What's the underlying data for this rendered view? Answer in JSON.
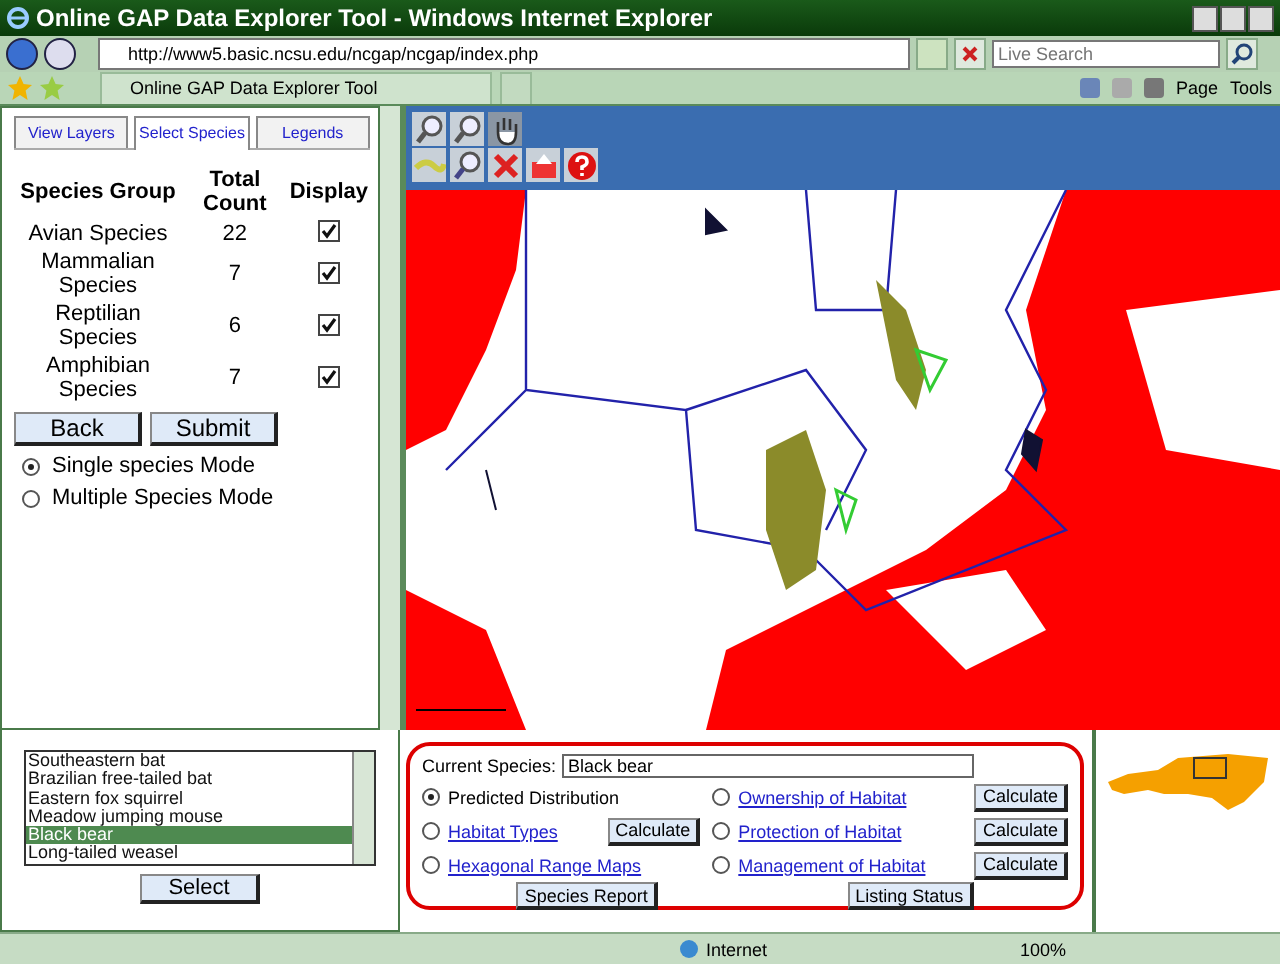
{
  "window": {
    "title": "Online GAP Data Explorer Tool - Windows Internet Explorer"
  },
  "browser": {
    "address": "http://www5.basic.ncsu.edu/ncgap/ncgap/index.php",
    "search": {
      "placeholder": "Live Search"
    },
    "tab_title": "Online GAP Data Explorer Tool",
    "commands": [
      {
        "label": "Page"
      },
      {
        "label": "Tools"
      }
    ]
  },
  "left_panel": {
    "tabs": [
      {
        "label": "View Layers",
        "selected": false
      },
      {
        "label": "Select Species",
        "selected": true
      },
      {
        "label": "Legends",
        "selected": false
      }
    ],
    "table": {
      "columns": [
        "Species Group",
        "Total Count",
        "Display"
      ],
      "rows": [
        {
          "group": "Avian Species",
          "count": "22",
          "checked": true
        },
        {
          "group": "Mammalian Species",
          "count": "7",
          "checked": true
        },
        {
          "group": "Reptilian Species",
          "count": "6",
          "checked": true
        },
        {
          "group": "Amphibian Species",
          "count": "7",
          "checked": true
        }
      ]
    },
    "buttons": [
      "Back",
      "Submit"
    ],
    "modes": [
      {
        "label": "Single species Mode",
        "selected": true
      },
      {
        "label": "Multiple Species Mode",
        "selected": false
      }
    ]
  },
  "species_list": {
    "items": [
      {
        "label": "Southeastern bat",
        "selected": false
      },
      {
        "label": "Brazilian free-tailed bat",
        "selected": false
      },
      {
        "label": "Eastern fox squirrel",
        "selected": false
      },
      {
        "label": "Meadow jumping mouse",
        "selected": false
      },
      {
        "label": "Black bear",
        "selected": true
      },
      {
        "label": "Long-tailed weasel",
        "selected": false
      }
    ],
    "button": "Select"
  },
  "analysis": {
    "current_label": "Current Species:",
    "current_value": "Black bear",
    "options": [
      {
        "label": "Predicted Distribution",
        "kind": "plain",
        "selected": true
      },
      {
        "label": "Ownership of Habitat",
        "kind": "link",
        "selected": false,
        "button": "Calculate"
      },
      {
        "label": "Habitat Types",
        "kind": "link",
        "selected": false,
        "button": "Calculate"
      },
      {
        "label": "Protection of Habitat",
        "kind": "link",
        "selected": false,
        "button": "Calculate"
      },
      {
        "label": "Hexagonal Range Maps",
        "kind": "link",
        "selected": false
      },
      {
        "label": "Management of Habitat",
        "kind": "link",
        "selected": false,
        "button": "Calculate"
      }
    ],
    "buttons": [
      "Species Report",
      "Listing Status"
    ]
  },
  "status_bar": {
    "zone": "Internet",
    "zoom": "100%"
  }
}
